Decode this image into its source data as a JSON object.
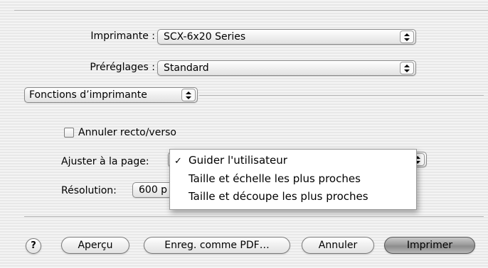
{
  "print_dialog": {
    "printer": {
      "label": "Imprimante :",
      "value": "SCX-6x20 Series"
    },
    "presets": {
      "label": "Préréglages :",
      "value": "Standard"
    },
    "section_popup": {
      "value": "Fonctions d’imprimante"
    }
  },
  "options": {
    "duplex_cancel": {
      "label": "Annuler recto/verso",
      "checked": false
    },
    "fit_to_page": {
      "label": "Ajuster à la page:",
      "menu_items": [
        {
          "label": "Guider l'utilisateur",
          "checked": true
        },
        {
          "label": "Taille et échelle les plus proches",
          "checked": false
        },
        {
          "label": "Taille et découpe les plus proches",
          "checked": false
        }
      ]
    },
    "resolution": {
      "label": "Résolution:",
      "value_visible": "600 p"
    }
  },
  "buttons": {
    "help": "?",
    "preview": "Aperçu",
    "save_pdf": "Enreg. comme PDF…",
    "cancel": "Annuler",
    "print": "Imprimer"
  },
  "icons": {
    "popup_arrows": "up-down-arrows-icon",
    "checkmark": "checkmark-icon",
    "help": "help-icon"
  }
}
